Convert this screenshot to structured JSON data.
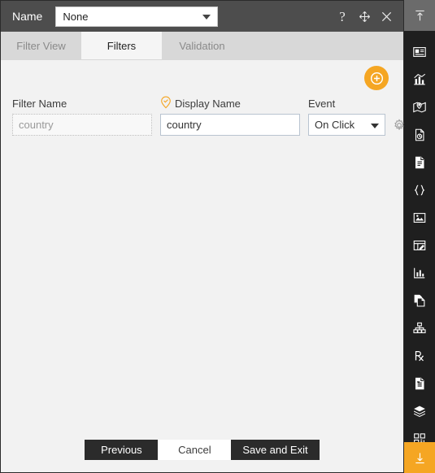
{
  "titlebar": {
    "label": "Name",
    "selected_value": "None",
    "help_icon": "question-mark-icon",
    "move_icon": "move-cross-icon",
    "close_icon": "close-x-icon"
  },
  "tabs": [
    {
      "label": "Filter View",
      "active": false
    },
    {
      "label": "Filters",
      "active": true
    },
    {
      "label": "Validation",
      "active": false
    }
  ],
  "toolbar": {
    "add_label": "+",
    "add_icon": "plus-circle-icon"
  },
  "filter_table": {
    "headers": {
      "filter_name": "Filter Name",
      "display_name": "Display Name",
      "display_name_icon": "map-pin-check-icon",
      "event": "Event"
    },
    "rows": [
      {
        "filter_name": "country",
        "display_name": "country",
        "event": "On Click",
        "settings_icon": "gear-icon",
        "delete_icon": "trash-icon"
      }
    ]
  },
  "footer": {
    "previous": "Previous",
    "cancel": "Cancel",
    "save_and_exit": "Save and Exit"
  },
  "rail": {
    "top_icon": "collapse-up-icon",
    "items": [
      "dashboard-panel-icon",
      "bar-chart-icon",
      "map-icon",
      "document-refresh-icon",
      "document-text-icon",
      "code-braces-icon",
      "image-icon",
      "table-edit-icon",
      "sparkline-chart-icon",
      "copy-document-icon",
      "hierarchy-icon",
      "prescription-rx-icon",
      "report-document-icon",
      "layers-stack-icon",
      "grid-blocks-icon"
    ],
    "bottom_icon": "download-arrow-icon"
  },
  "colors": {
    "accent": "#f5a623",
    "titlebar": "#4d4d4d",
    "rail": "#1f1f1f",
    "dark_button": "#2b2b2b"
  }
}
